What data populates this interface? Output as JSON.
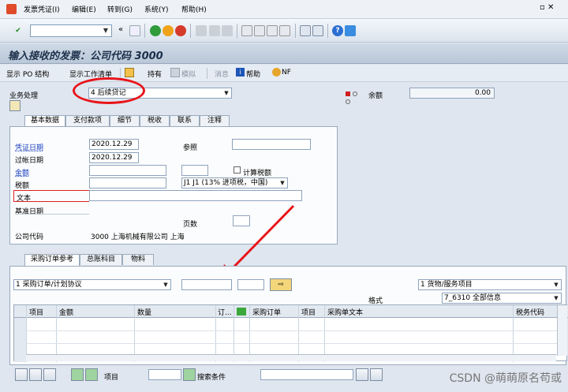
{
  "menu": [
    "发票凭证(I)",
    "编辑(E)",
    "转到(G)",
    "系统(Y)",
    "帮助(H)"
  ],
  "command_field": {
    "value": ""
  },
  "title": "输入接收的发票：公司代码 3000",
  "app_toolbar": {
    "po_structure": "显示 PO 结构",
    "worklist": "显示工作清单",
    "hold": "持有",
    "simulate": "模拟",
    "messages": "消息",
    "help": "帮助",
    "nf": "NF"
  },
  "transaction": {
    "label": "业务处理",
    "value": "4 后续贷记"
  },
  "balance": {
    "label": "余额",
    "value": "0.00"
  },
  "main_tabs": [
    "基本数据",
    "支付款项",
    "细节",
    "税收",
    "联系",
    "注释"
  ],
  "basic": {
    "invoice_date_label": "凭证日期",
    "invoice_date": "2020.12.29",
    "reference_label": "参照",
    "reference": "",
    "posting_date_label": "过帐日期",
    "posting_date": "2020.12.29",
    "amount_label": "金额",
    "amount": "",
    "currency": "",
    "calc_tax_label": "计算税额",
    "tax_label": "税额",
    "tax": "",
    "tax_code": "J1 J1 (13% 进项税，中国)",
    "text_label": "文本",
    "text": "",
    "baseline_label": "基准日期",
    "page_label": "页数",
    "page": "",
    "company_label": "公司代码",
    "company_value": "3000 上海机械有限公司 上海"
  },
  "ref_tabs": [
    "采购订单参考",
    "总账科目",
    "物料"
  ],
  "ref": {
    "doc_type": "1 采购订单/计划协议",
    "po_number": "",
    "po_item": "",
    "item_type": "1 货物/服务项目",
    "layout_label": "格式",
    "layout": "7_6310 全部信息"
  },
  "grid_headers": [
    "项目",
    "金额",
    "数量",
    "订...",
    "",
    "采购订单",
    "项目",
    "采购单文本",
    "税务代码"
  ],
  "bottom": {
    "item_label": "项目",
    "item_value": "",
    "search_label": "搜索条件",
    "search_value": ""
  },
  "watermark": "CSDN @萌萌原名苟或"
}
